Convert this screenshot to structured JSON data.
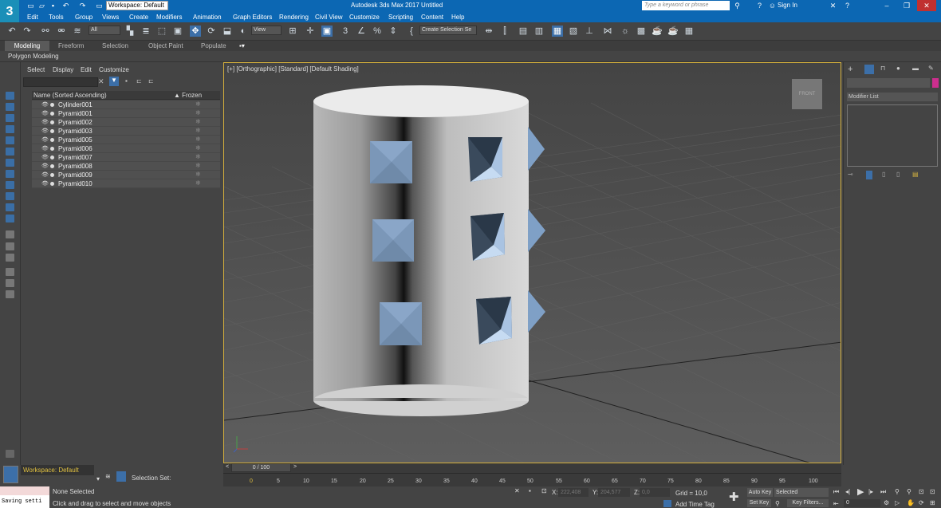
{
  "titlebar": {
    "app_logo": "3",
    "workspace": "Workspace: Default",
    "title": "Autodesk 3ds Max 2017     Untitled",
    "search_placeholder": "Type a keyword or phrase",
    "signin": "Sign In"
  },
  "menu": [
    "Edit",
    "Tools",
    "Group",
    "Views",
    "Create",
    "Modifiers",
    "Animation",
    "Graph Editors",
    "Rendering",
    "Civil View",
    "Customize",
    "Scripting",
    "Content",
    "Help"
  ],
  "toolbar": {
    "filter": "All",
    "ref_coord": "View",
    "selection_set": "Create Selection Se"
  },
  "ribbon": {
    "tabs": [
      "Modeling",
      "Freeform",
      "Selection",
      "Object Paint",
      "Populate"
    ],
    "panel": "Polygon Modeling"
  },
  "scene_explorer": {
    "menus": [
      "Select",
      "Display",
      "Edit",
      "Customize"
    ],
    "col_name": "Name (Sorted Ascending)",
    "col_frozen": "▲ Frozen",
    "objects": [
      "Cylinder001",
      "Pyramid001",
      "Pyramid002",
      "Pyramid003",
      "Pyramid005",
      "Pyramid006",
      "Pyramid007",
      "Pyramid008",
      "Pyramid009",
      "Pyramid010"
    ]
  },
  "viewport": {
    "label": "[+] [Orthographic] [Standard] [Default Shading]",
    "viewcube": "FRONT"
  },
  "command_panel": {
    "modifier_list": "Modifier List"
  },
  "timeline": {
    "slider": "0 / 100",
    "ticks": [
      "0",
      "5",
      "10",
      "15",
      "20",
      "25",
      "30",
      "35",
      "40",
      "45",
      "50",
      "55",
      "60",
      "65",
      "70",
      "75",
      "80",
      "85",
      "90",
      "95",
      "100"
    ]
  },
  "status": {
    "workspace": "Workspace: Default",
    "selection_set": "Selection Set:",
    "maxscript": "Saving setti",
    "selected": "None Selected",
    "prompt": "Click and drag to select and move objects",
    "x": "222,408",
    "y": "204,577",
    "z": "0,0",
    "grid": "Grid = 10,0",
    "add_time_tag": "Add Time Tag",
    "auto_key": "Auto Key",
    "set_key": "Set Key",
    "selected_dd": "Selected",
    "key_filters": "Key Filters...",
    "frame": "0"
  }
}
